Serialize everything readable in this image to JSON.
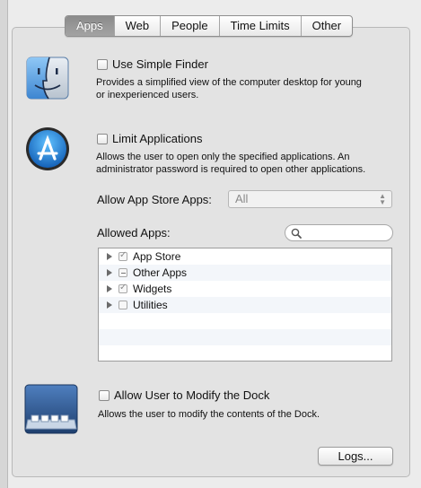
{
  "tabs": [
    {
      "label": "Apps",
      "selected": true
    },
    {
      "label": "Web",
      "selected": false
    },
    {
      "label": "People",
      "selected": false
    },
    {
      "label": "Time Limits",
      "selected": false
    },
    {
      "label": "Other",
      "selected": false
    }
  ],
  "simple_finder": {
    "checkbox_label": "Use Simple Finder",
    "description": "Provides a simplified view of the computer desktop for young or inexperienced users.",
    "icon": "finder-icon",
    "checked": false
  },
  "limit_apps": {
    "checkbox_label": "Limit Applications",
    "description": "Allows the user to open only the specified applications. An administrator password is required to open other applications.",
    "icon": "app-store-icon",
    "checked": false,
    "app_store_label": "Allow App Store Apps:",
    "app_store_value": "All",
    "allowed_label": "Allowed Apps:",
    "search_placeholder": "",
    "items": [
      {
        "label": "App Store",
        "state": "checked"
      },
      {
        "label": "Other Apps",
        "state": "mixed"
      },
      {
        "label": "Widgets",
        "state": "checked"
      },
      {
        "label": "Utilities",
        "state": "unchecked"
      }
    ]
  },
  "dock": {
    "checkbox_label": "Allow User to Modify the Dock",
    "description": "Allows the user to modify the contents of the Dock.",
    "icon": "dock-icon",
    "checked": false
  },
  "logs_button": "Logs...",
  "colors": {
    "selected_tab": "#999999",
    "app_store_blue": "#1f7fd6",
    "dock_blue": "#2f5e9a"
  }
}
